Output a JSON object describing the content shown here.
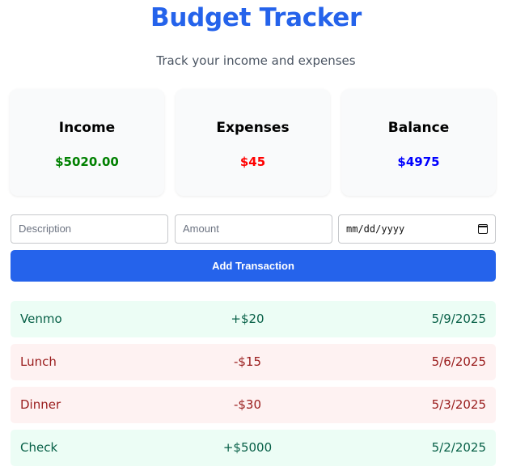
{
  "header": {
    "title": "Budget Tracker",
    "subtitle": "Track your income and expenses"
  },
  "summary": {
    "income": {
      "label": "Income",
      "value": "$5020.00",
      "color": "#008000"
    },
    "expenses": {
      "label": "Expenses",
      "value": "$45",
      "color": "#ff0000"
    },
    "balance": {
      "label": "Balance",
      "value": "$4975",
      "color": "#0000ff"
    }
  },
  "form": {
    "description_placeholder": "Description",
    "amount_placeholder": "Amount",
    "date_placeholder": "mm/dd/yyyy",
    "add_button_label": "Add Transaction"
  },
  "transactions": [
    {
      "description": "Venmo",
      "amount": "+$20",
      "date": "5/9/2025",
      "type": "income"
    },
    {
      "description": "Lunch",
      "amount": "-$15",
      "date": "5/6/2025",
      "type": "expense"
    },
    {
      "description": "Dinner",
      "amount": "-$30",
      "date": "5/3/2025",
      "type": "expense"
    },
    {
      "description": "Check",
      "amount": "+$5000",
      "date": "5/2/2025",
      "type": "income"
    }
  ],
  "colors": {
    "accent": "#2563eb",
    "income_row_bg": "#ecfdf5",
    "expense_row_bg": "#fef2f2"
  }
}
